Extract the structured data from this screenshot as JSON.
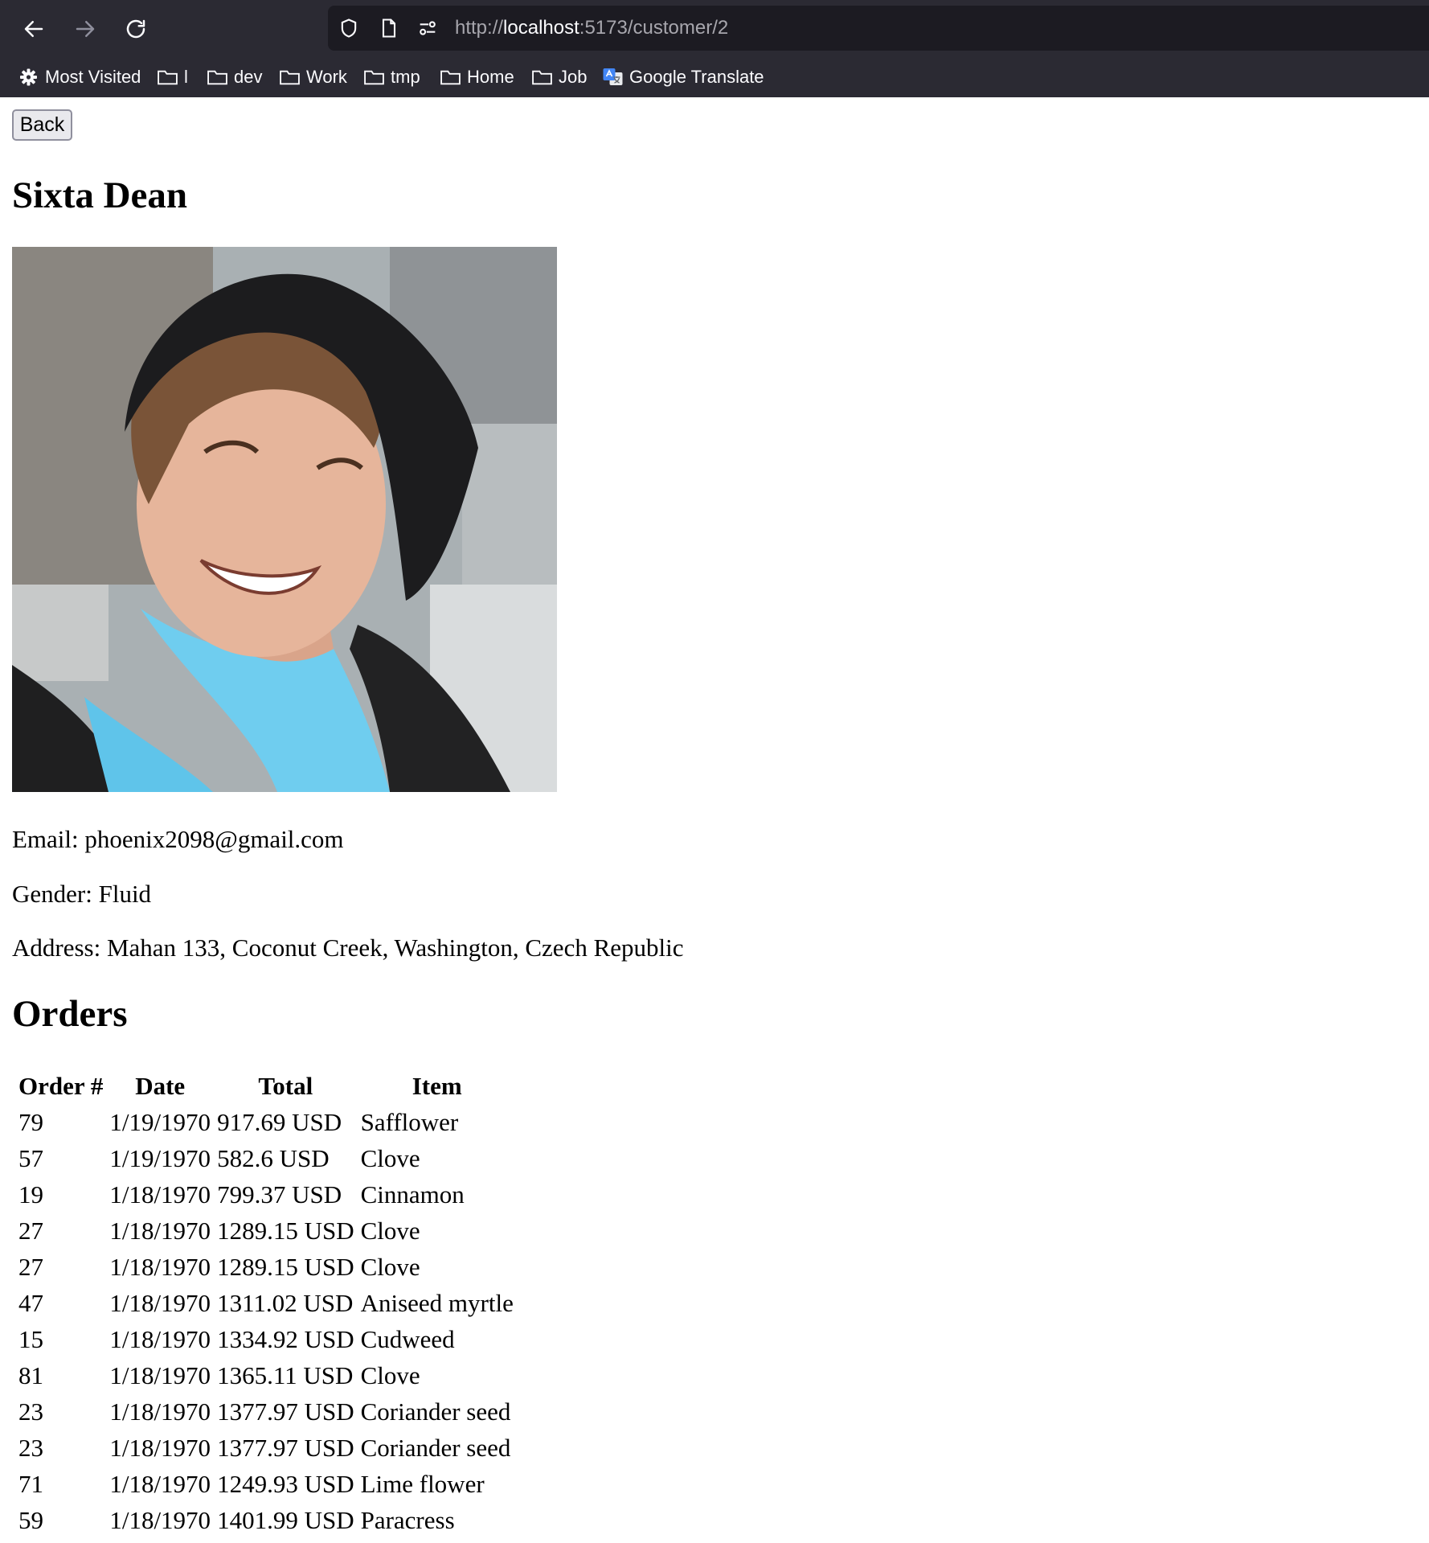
{
  "browser": {
    "url_scheme": "http://",
    "url_host": "localhost",
    "url_rest": ":5173/customer/2",
    "bookmarks": [
      {
        "label": "Most Visited",
        "icon": "gear-icon"
      },
      {
        "label": "l",
        "icon": "folder-icon"
      },
      {
        "label": "dev",
        "icon": "folder-icon"
      },
      {
        "label": "Work",
        "icon": "folder-icon"
      },
      {
        "label": "tmp",
        "icon": "folder-icon"
      },
      {
        "label": "Home",
        "icon": "folder-icon"
      },
      {
        "label": "Job",
        "icon": "folder-icon"
      },
      {
        "label": "Google Translate",
        "icon": "google-translate-icon"
      }
    ]
  },
  "page": {
    "back_label": "Back",
    "customer_name": "Sixta Dean",
    "email_line": "Email: phoenix2098@gmail.com",
    "gender_line": "Gender: Fluid",
    "address_line": "Address: Mahan 133, Coconut Creek, Washington, Czech Republic",
    "orders_title": "Orders",
    "columns": [
      "Order #",
      "Date",
      "Total",
      "Item"
    ],
    "orders": [
      [
        "79",
        "1/19/1970",
        "917.69 USD",
        "Safflower"
      ],
      [
        "57",
        "1/19/1970",
        "582.6 USD",
        "Clove"
      ],
      [
        "19",
        "1/18/1970",
        "799.37 USD",
        "Cinnamon"
      ],
      [
        "27",
        "1/18/1970",
        "1289.15 USD",
        "Clove"
      ],
      [
        "27",
        "1/18/1970",
        "1289.15 USD",
        "Clove"
      ],
      [
        "47",
        "1/18/1970",
        "1311.02 USD",
        "Aniseed myrtle"
      ],
      [
        "15",
        "1/18/1970",
        "1334.92 USD",
        "Cudweed"
      ],
      [
        "81",
        "1/18/1970",
        "1365.11 USD",
        "Clove"
      ],
      [
        "23",
        "1/18/1970",
        "1377.97 USD",
        "Coriander seed"
      ],
      [
        "23",
        "1/18/1970",
        "1377.97 USD",
        "Coriander seed"
      ],
      [
        "71",
        "1/18/1970",
        "1249.93 USD",
        "Lime flower"
      ],
      [
        "59",
        "1/18/1970",
        "1401.99 USD",
        "Paracress"
      ]
    ]
  }
}
